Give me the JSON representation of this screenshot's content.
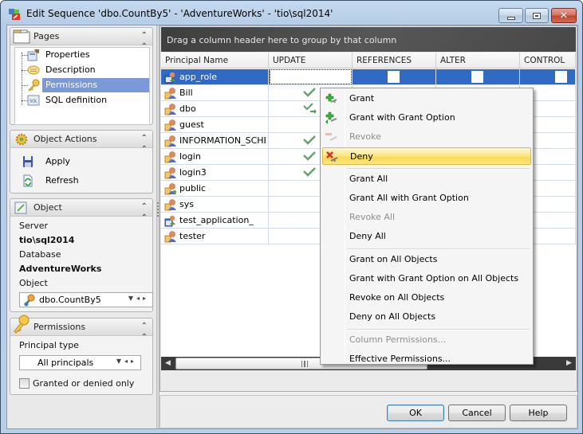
{
  "window": {
    "title": "Edit Sequence 'dbo.CountBy5' - 'AdventureWorks' - 'tio\\sql2014'",
    "controls": {
      "minimize": "minimize",
      "maximize": "maximize",
      "close": "✕"
    }
  },
  "sidebar": {
    "pages": {
      "title": "Pages",
      "items": [
        {
          "label": "Properties",
          "icon": "properties-icon"
        },
        {
          "label": "Description",
          "icon": "description-icon"
        },
        {
          "label": "Permissions",
          "icon": "key-icon",
          "selected": true
        },
        {
          "label": "SQL definition",
          "icon": "sql-icon"
        }
      ]
    },
    "object_actions": {
      "title": "Object Actions",
      "items": [
        {
          "label": "Apply",
          "icon": "save-icon"
        },
        {
          "label": "Refresh",
          "icon": "refresh-icon"
        }
      ]
    },
    "object": {
      "title": "Object",
      "server_label": "Server",
      "server_value": "tio\\sql2014",
      "database_label": "Database",
      "database_value": "AdventureWorks",
      "object_label": "Object",
      "object_value": "dbo.CountBy5"
    },
    "permissions": {
      "title": "Permissions",
      "principal_type_label": "Principal type",
      "principal_type_value": "All principals",
      "granted_only_label": "Granted or denied only",
      "granted_only_checked": false
    }
  },
  "grid": {
    "group_hint": "Drag a column header here to group by that column",
    "columns": [
      "Principal Name",
      "UPDATE",
      "REFERENCES",
      "ALTER",
      "CONTROL"
    ],
    "rows": [
      {
        "name": "app_role",
        "type": "app-role",
        "update": "focused",
        "selected": true
      },
      {
        "name": "Bill",
        "type": "user",
        "update": "granted"
      },
      {
        "name": "dbo",
        "type": "user",
        "update": "granted-with-grant"
      },
      {
        "name": "guest",
        "type": "user",
        "update": ""
      },
      {
        "name": "INFORMATION_SCHEMA",
        "type": "user",
        "update": "granted"
      },
      {
        "name": "login",
        "type": "user",
        "update": "granted"
      },
      {
        "name": "login3",
        "type": "user",
        "update": "granted"
      },
      {
        "name": "public",
        "type": "role",
        "update": ""
      },
      {
        "name": "sys",
        "type": "user",
        "update": ""
      },
      {
        "name": "test_application_role",
        "type": "app-role",
        "update": ""
      },
      {
        "name": "tester",
        "type": "user",
        "update": ""
      }
    ]
  },
  "context_menu": {
    "items": [
      {
        "label": "Grant",
        "icon": "grant-icon",
        "disabled": false
      },
      {
        "label": "Grant with Grant Option",
        "icon": "grant-with-grant-icon",
        "disabled": false
      },
      {
        "label": "Revoke",
        "icon": "revoke-icon",
        "disabled": true
      },
      {
        "label": "Deny",
        "icon": "deny-icon",
        "disabled": false,
        "hover": true
      },
      {
        "label": "Grant All",
        "disabled": false
      },
      {
        "label": "Grant All with Grant Option",
        "disabled": false
      },
      {
        "label": "Revoke All",
        "disabled": true
      },
      {
        "label": "Deny All",
        "disabled": false
      },
      {
        "label": "Grant on All Objects",
        "disabled": false
      },
      {
        "label": "Grant with Grant Option on All Objects",
        "disabled": false
      },
      {
        "label": "Revoke on All Objects",
        "disabled": false
      },
      {
        "label": "Deny on All Objects",
        "disabled": false
      },
      {
        "label": "Column Permissions...",
        "disabled": true
      },
      {
        "label": "Effective Permissions...",
        "disabled": false
      }
    ]
  },
  "buttons": {
    "ok": "OK",
    "cancel": "Cancel",
    "help": "Help"
  },
  "colors": {
    "selection": "#316ac5",
    "tree_selection": "#7b99d6",
    "menu_hover": "#fbe67d",
    "check_green": "#6a9e6a"
  }
}
